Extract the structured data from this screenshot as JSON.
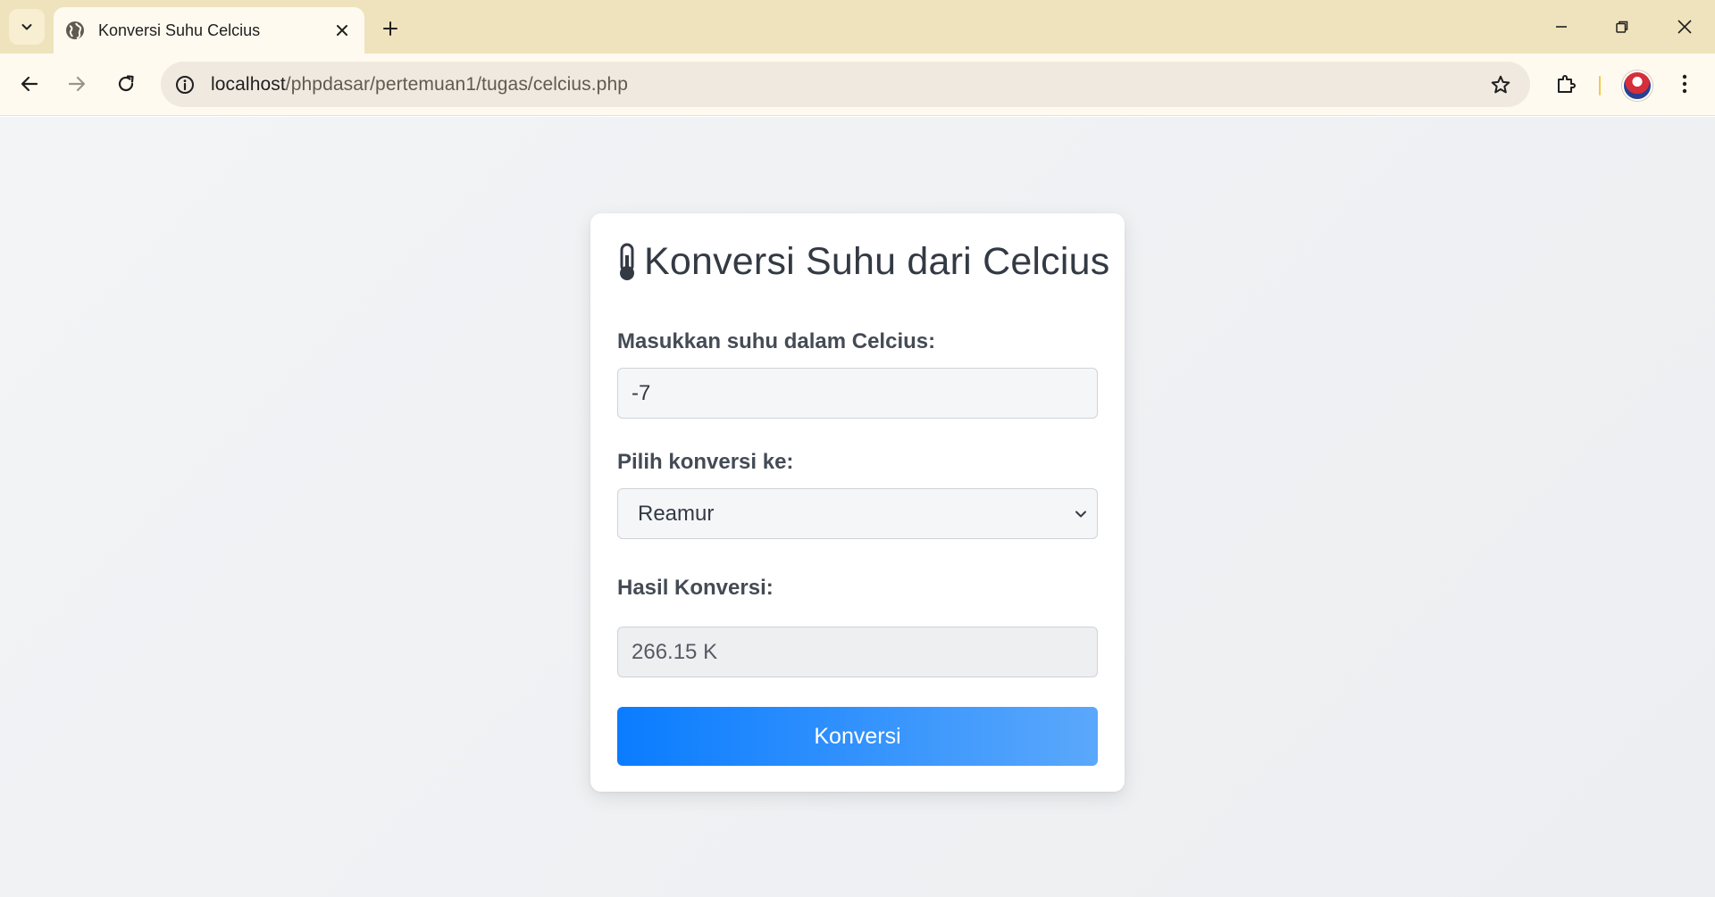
{
  "browser": {
    "tab": {
      "title": "Konversi Suhu Celcius"
    },
    "address_bar": {
      "url_host": "localhost",
      "url_path": "/phpdasar/pertemuan1/tugas/celcius.php"
    },
    "colors": {
      "titlebar": "#efe3bd",
      "toolbar": "#fffaf0"
    }
  },
  "page": {
    "title": "Konversi Suhu dari Celcius",
    "title_icon": "thermometer-icon",
    "celsius_label": "Masukkan suhu dalam Celcius:",
    "celsius_value": "-7",
    "convert_label": "Pilih konversi ke:",
    "convert_selected": "Reamur",
    "result_label": "Hasil Konversi:",
    "result_value": "266.15 K",
    "submit_label": "Konversi",
    "colors": {
      "button_start": "#0a7cff",
      "button_end": "#5ba8fb",
      "background": "#f3f4f6"
    }
  }
}
